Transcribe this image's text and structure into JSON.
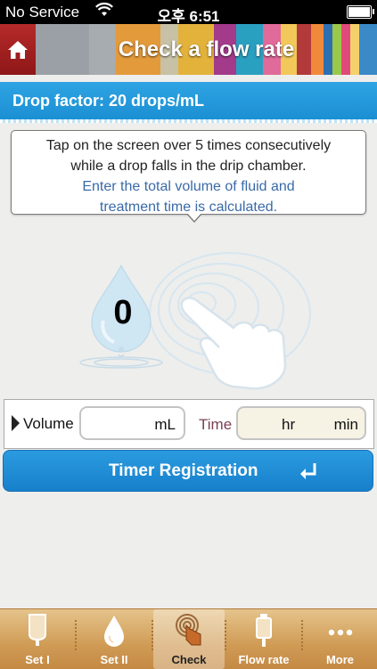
{
  "status_bar": {
    "carrier": "No Service",
    "time": "오후 6:51"
  },
  "header": {
    "title": "Check a flow rate"
  },
  "drop_factor": {
    "text": "Drop factor: 20 drops/mL"
  },
  "instructions": {
    "line1": "Tap on the screen over 5 times consecutively",
    "line2": "while a drop falls in the drip chamber.",
    "line3": "Enter the total volume of fluid and",
    "line4": "treatment time is calculated."
  },
  "tap_counter": {
    "value": "0"
  },
  "inputs": {
    "volume_label": "Volume",
    "volume_unit": "mL",
    "volume_value": "",
    "time_label": "Time",
    "time_hr_unit": "hr",
    "time_min_unit": "min"
  },
  "timer_button": {
    "label": "Timer Registration"
  },
  "tabs": [
    {
      "label": "Set I",
      "icon": "iv-bag-icon"
    },
    {
      "label": "Set II",
      "icon": "drop-icon"
    },
    {
      "label": "Check",
      "icon": "tap-icon",
      "active": true
    },
    {
      "label": "Flow rate",
      "icon": "syringe-icon"
    },
    {
      "label": "More",
      "icon": "more-icon"
    }
  ],
  "colors": {
    "accent_blue": "#1b8fd3",
    "title_red": "#b62a2a",
    "time_label": "#7a3f55"
  }
}
